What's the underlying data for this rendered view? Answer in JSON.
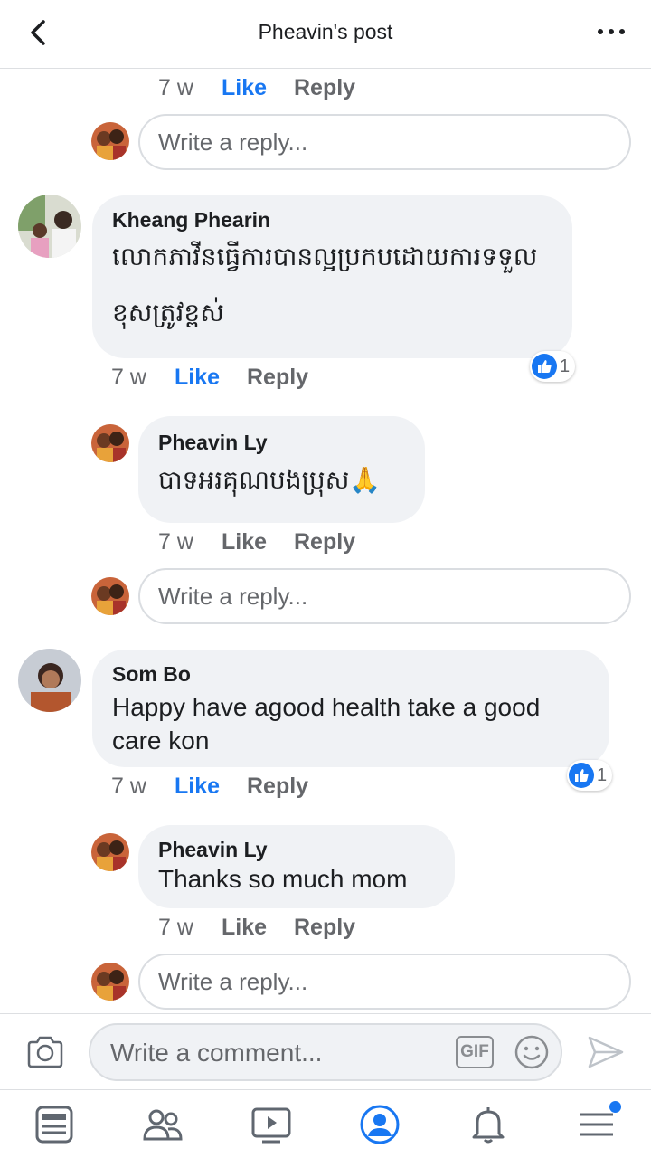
{
  "header": {
    "title": "Pheavin's post"
  },
  "thread": {
    "top_actions": {
      "time": "7 w",
      "like": "Like",
      "reply": "Reply"
    },
    "reply_placeholder": "Write a reply...",
    "comments": [
      {
        "author": "Kheang Phearin",
        "text": "លោកភាវីនធ្វើការបានល្អប្រកបដោយការទទួលខុសត្រូវខ្ពស់",
        "time": "7 w",
        "like": "Like",
        "reply": "Reply",
        "reaction_count": "1",
        "replies": [
          {
            "author": "Pheavin Ly",
            "text": "បាទអរគុណបងប្រុស🙏",
            "time": "7 w",
            "like": "Like",
            "reply": "Reply"
          }
        ]
      },
      {
        "author": "Som Bo",
        "text": "Happy have agood health take a good care kon",
        "time": "7 w",
        "like": "Like",
        "reply": "Reply",
        "reaction_count": "1",
        "replies": [
          {
            "author": "Pheavin Ly",
            "text": "Thanks so much mom",
            "time": "7 w",
            "like": "Like",
            "reply": "Reply"
          }
        ]
      }
    ]
  },
  "composer": {
    "placeholder": "Write a comment...",
    "gif_label": "GIF"
  },
  "nav": {
    "items": [
      "news-feed-icon",
      "friends-icon",
      "watch-icon",
      "profile-icon",
      "notifications-icon",
      "menu-icon"
    ]
  },
  "colors": {
    "accent": "#1877f2",
    "bubble": "#f0f2f5",
    "muted": "#65676b"
  }
}
